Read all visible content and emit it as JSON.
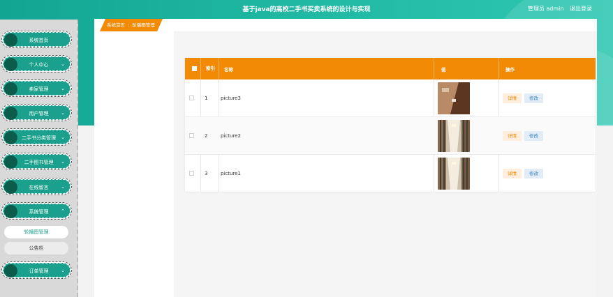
{
  "header": {
    "title": "基于java的高校二手书买卖系统的设计与实现",
    "user_label": "管理员 admin",
    "logout": "退出登录"
  },
  "sidebar": {
    "items": [
      {
        "label": "系统首页",
        "chevron": ""
      },
      {
        "label": "个人中心",
        "chevron": "⌄"
      },
      {
        "label": "卖家管理",
        "chevron": "⌄"
      },
      {
        "label": "用户管理",
        "chevron": "⌄"
      },
      {
        "label": "二手书分类管理",
        "chevron": "⌄"
      },
      {
        "label": "二手图书管理",
        "chevron": "⌄"
      },
      {
        "label": "在线留言",
        "chevron": "⌄"
      },
      {
        "label": "系统管理",
        "chevron": "⌃"
      },
      {
        "label": "订单管理",
        "chevron": "⌄"
      }
    ],
    "sub_items": [
      {
        "label": "轮播图管理"
      },
      {
        "label": "公告栏"
      }
    ]
  },
  "breadcrumb": {
    "home": "系统首页",
    "separator": ":",
    "current": "轮播图管理"
  },
  "table": {
    "columns": [
      "索引",
      "名称",
      "值",
      "操作"
    ],
    "rows": [
      {
        "index": "1",
        "name": "picture3",
        "image": "room-photo-icon"
      },
      {
        "index": "2",
        "name": "picture2",
        "image": "hallway-photo-icon"
      },
      {
        "index": "3",
        "name": "picture1",
        "image": "hallway-photo-icon"
      }
    ],
    "actions": {
      "detail": "详情",
      "edit": "修改"
    }
  },
  "colors": {
    "teal": "#1aa08c",
    "orange": "#f28a05",
    "edit_blue": "#3b82c4"
  }
}
